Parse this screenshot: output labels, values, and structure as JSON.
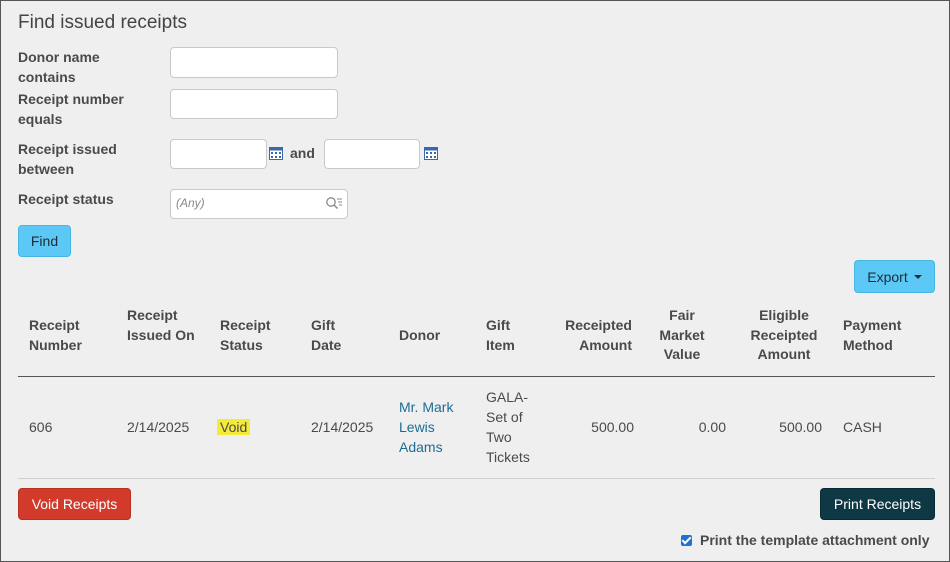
{
  "title": "Find issued receipts",
  "filters": {
    "donor_name_label": "Donor name contains",
    "receipt_number_label": "Receipt number equals",
    "issued_between_label": "Receipt issued between",
    "and_label": "and",
    "status_label": "Receipt status",
    "status_placeholder": "(Any)",
    "donor_name_value": "",
    "receipt_number_value": "",
    "date_from_value": "",
    "date_to_value": ""
  },
  "buttons": {
    "find": "Find",
    "export": "Export",
    "void_receipts": "Void Receipts",
    "print_receipts": "Print Receipts"
  },
  "table": {
    "columns": [
      "Receipt Number",
      "Receipt Issued On",
      "Receipt Status",
      "Gift Date",
      "Donor",
      "Gift Item",
      "Receipted Amount",
      "Fair Market Value",
      "Eligible Receipted Amount",
      "Payment Method"
    ],
    "rows": [
      {
        "receipt_number": "606",
        "issued_on": "2/14/2025",
        "status": "Void",
        "gift_date": "2/14/2025",
        "donor": "Mr. Mark Lewis Adams",
        "gift_item": "GALA- Set of Two Tickets",
        "receipted_amount": "500.00",
        "fair_market_value": "0.00",
        "eligible_amount": "500.00",
        "payment_method": "CASH"
      }
    ]
  },
  "print_template_only": {
    "label": "Print the template attachment only",
    "checked": true
  },
  "colors": {
    "primary_button": "#5bc8f5",
    "danger_button": "#d23a2c",
    "dark_button": "#0e3944",
    "link": "#1e6c93",
    "void_highlight": "#f3ea3a"
  }
}
